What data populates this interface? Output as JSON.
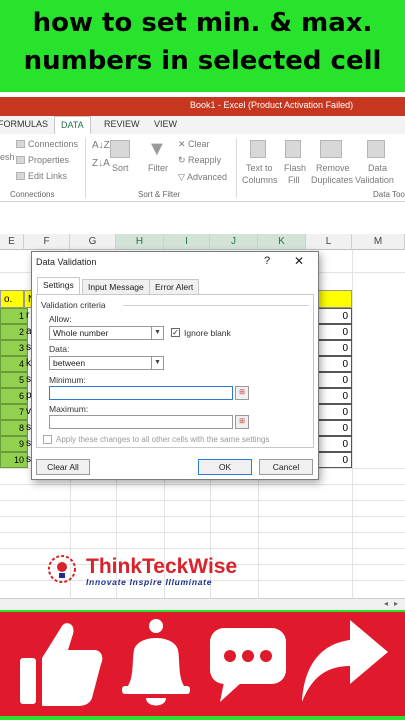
{
  "banner": {
    "line1": "how to set min. & max.",
    "line2": "numbers in selected cell"
  },
  "excel": {
    "title": "Book1 - Excel (Product Activation Failed)",
    "tabs": [
      "FORMULAS",
      "DATA",
      "REVIEW",
      "VIEW"
    ],
    "active_tab": "DATA",
    "ribbon": {
      "connections": [
        "Connections",
        "Properties",
        "Edit Links"
      ],
      "refresh_label": "esh",
      "sort": "Sort",
      "filter": "Filter",
      "clear": "Clear",
      "reapply": "Reapply",
      "advanced": "Advanced",
      "text_to_columns": [
        "Text to",
        "Columns"
      ],
      "flash_fill": [
        "Flash",
        "Fill"
      ],
      "remove_duplicates": [
        "Remove",
        "Duplicates"
      ],
      "data_validation": [
        "Data",
        "Validation"
      ],
      "group_connections": "Connections",
      "group_sort_filter": "Sort & Filter",
      "group_data_tools": "Data Too"
    },
    "columns": [
      "E",
      "F",
      "G",
      "H",
      "I",
      "J",
      "K",
      "L",
      "M"
    ],
    "selected_columns": [
      "H",
      "I",
      "J",
      "K"
    ],
    "header_left": "o.",
    "header_col_f": "N",
    "header_right": "al",
    "row_numbers": [
      "1",
      "2",
      "3",
      "4",
      "5",
      "6",
      "7",
      "8",
      "9",
      "10"
    ],
    "row_letters": [
      "r",
      "a",
      "s",
      "k",
      "s",
      "p",
      "v",
      "s",
      "s",
      "s"
    ],
    "totals": [
      "0",
      "0",
      "0",
      "0",
      "0",
      "0",
      "0",
      "0",
      "0",
      "0"
    ]
  },
  "dialog": {
    "title": "Data Validation",
    "help": "?",
    "close": "✕",
    "tabs": [
      "Settings",
      "Input Message",
      "Error Alert"
    ],
    "active_tab": "Settings",
    "section": "Validation criteria",
    "allow_label": "Allow:",
    "allow_value": "Whole number",
    "ignore_blank_label": "Ignore blank",
    "ignore_blank_checked": true,
    "data_label": "Data:",
    "data_value": "between",
    "minimum_label": "Minimum:",
    "minimum_value": "",
    "maximum_label": "Maximum:",
    "maximum_value": "",
    "apply_all_label": "Apply these changes to all other cells with the same settings",
    "clear_all": "Clear All",
    "ok": "OK",
    "cancel": "Cancel"
  },
  "brand": {
    "name": "ThinkTeckWise",
    "tagline": "Innovate Inspire Illuminate"
  },
  "colors": {
    "green": "#28e32c",
    "red": "#e0192c",
    "excel_green": "#217346",
    "title_red": "#c7361f"
  }
}
